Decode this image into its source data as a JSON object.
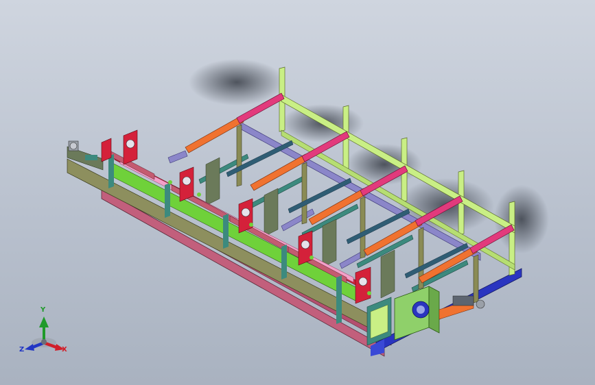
{
  "viewport": {
    "background_top": "#cfd5df",
    "background_bottom": "#a9b2c0"
  },
  "model": {
    "part_colors": {
      "magenta": "#e23a7c",
      "orange": "#f07230",
      "lime": "#c9ef85",
      "green": "#6fd13a",
      "violet": "#8b86c9",
      "blue": "#2a35c0",
      "teal": "#3c8a7e",
      "olive": "#8a8b55",
      "red": "#d4213a",
      "pink": "#f3a0c8"
    }
  },
  "triad": {
    "x_label": "X",
    "y_label": "Y",
    "z_label": "Z",
    "x_color": "#d11f2a",
    "y_color": "#1f9a2a",
    "z_color": "#2236c4"
  }
}
